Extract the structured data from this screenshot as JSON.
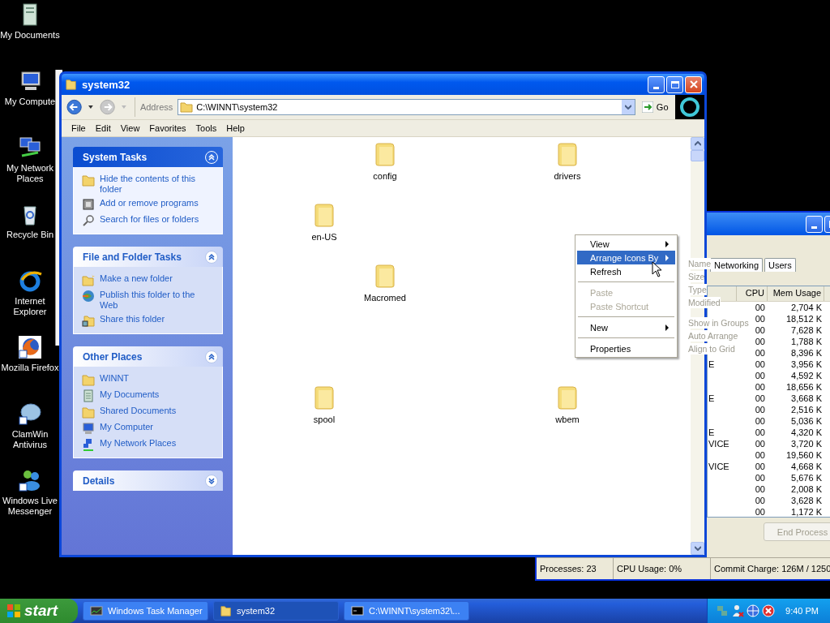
{
  "desktop_icons": [
    {
      "label": "My Documents"
    },
    {
      "label": "My Compute"
    },
    {
      "label": "My Network Places"
    },
    {
      "label": "Recycle Bin"
    },
    {
      "label": "Internet Explorer"
    },
    {
      "label": "Mozilla Firefox"
    },
    {
      "label": "ClamWin Antivirus"
    },
    {
      "label": "Windows Live Messenger"
    }
  ],
  "explorer": {
    "title": "system32",
    "address_label": "Address",
    "address": "C:\\WINNT\\system32",
    "go": "Go",
    "menu": [
      "File",
      "Edit",
      "View",
      "Favorites",
      "Tools",
      "Help"
    ],
    "task_panes": [
      {
        "title": "System Tasks",
        "kind": "primary",
        "expanded": true,
        "items": [
          "Hide the contents of this folder",
          "Add or remove programs",
          "Search for files or folders"
        ]
      },
      {
        "title": "File and Folder Tasks",
        "kind": "normal",
        "expanded": true,
        "items": [
          "Make a new folder",
          "Publish this folder to the Web",
          "Share this folder"
        ]
      },
      {
        "title": "Other Places",
        "kind": "normal",
        "expanded": true,
        "items": [
          "WINNT",
          "My Documents",
          "Shared Documents",
          "My Computer",
          "My Network Places"
        ]
      },
      {
        "title": "Details",
        "kind": "normal",
        "expanded": false
      }
    ],
    "folders": [
      "config",
      "drivers",
      "en-US",
      "Macromed",
      "spool",
      "wbem"
    ]
  },
  "context_menu": {
    "items": [
      {
        "kind": "item",
        "label": "View",
        "submenu": true,
        "selected": false,
        "disabled": false
      },
      {
        "kind": "item",
        "label": "Arrange Icons By",
        "submenu": true,
        "selected": true,
        "disabled": false
      },
      {
        "kind": "item",
        "label": "Refresh",
        "submenu": false,
        "selected": false,
        "disabled": false
      },
      {
        "kind": "separator"
      },
      {
        "kind": "item",
        "label": "Paste",
        "submenu": false,
        "selected": false,
        "disabled": true
      },
      {
        "kind": "item",
        "label": "Paste Shortcut",
        "submenu": false,
        "selected": false,
        "disabled": true
      },
      {
        "kind": "separator"
      },
      {
        "kind": "item",
        "label": "New",
        "submenu": true,
        "selected": false,
        "disabled": false
      },
      {
        "kind": "separator"
      },
      {
        "kind": "item",
        "label": "Properties",
        "submenu": false,
        "selected": false,
        "disabled": false
      }
    ],
    "submenu": [
      {
        "kind": "item",
        "label": "Name"
      },
      {
        "kind": "item",
        "label": "Size"
      },
      {
        "kind": "item",
        "label": "Type"
      },
      {
        "kind": "item",
        "label": "Modified"
      },
      {
        "kind": "separator"
      },
      {
        "kind": "item",
        "label": "Show in Groups"
      },
      {
        "kind": "item",
        "label": "Auto Arrange"
      },
      {
        "kind": "item",
        "label": "Align to Grid"
      }
    ]
  },
  "task_manager": {
    "tabs": [
      "Networking",
      "Users"
    ],
    "columns": [
      "CPU",
      "Mem Usage"
    ],
    "rows": [
      {
        "cpu": "00",
        "mem": "2,704 K"
      },
      {
        "cpu": "00",
        "mem": "18,512 K"
      },
      {
        "cpu": "00",
        "mem": "7,628 K"
      },
      {
        "cpu": "00",
        "mem": "1,788 K"
      },
      {
        "cpu": "00",
        "mem": "8,396 K"
      },
      {
        "name": "E",
        "cpu": "00",
        "mem": "3,956 K"
      },
      {
        "cpu": "00",
        "mem": "4,592 K"
      },
      {
        "cpu": "00",
        "mem": "18,656 K"
      },
      {
        "name": "E",
        "cpu": "00",
        "mem": "3,668 K"
      },
      {
        "cpu": "00",
        "mem": "2,516 K"
      },
      {
        "cpu": "00",
        "mem": "5,036 K"
      },
      {
        "name": "E",
        "cpu": "00",
        "mem": "4,320 K"
      },
      {
        "name": "VICE",
        "cpu": "00",
        "mem": "3,720 K"
      },
      {
        "cpu": "00",
        "mem": "19,560 K"
      },
      {
        "name": "VICE",
        "cpu": "00",
        "mem": "4,668 K"
      },
      {
        "cpu": "00",
        "mem": "5,676 K"
      },
      {
        "cpu": "00",
        "mem": "2,008 K"
      },
      {
        "cpu": "00",
        "mem": "3,628 K"
      },
      {
        "cpu": "00",
        "mem": "1,172 K"
      }
    ],
    "end_button": "End Process",
    "status": [
      "Processes: 23",
      "CPU Usage: 0%",
      "Commit Charge: 126M / 1250"
    ]
  },
  "taskbar": {
    "start": "start",
    "tasks": [
      {
        "label": "Windows Task Manager",
        "selected": false
      },
      {
        "label": "system32",
        "selected": true
      },
      {
        "label": "C:\\WINNT\\system32\\...",
        "selected": false
      }
    ],
    "clock": "9:40 PM"
  }
}
